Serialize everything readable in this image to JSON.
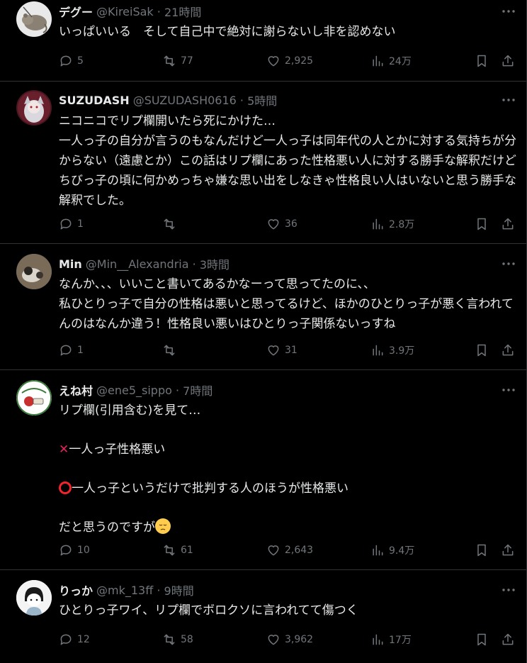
{
  "tweets": [
    {
      "name": "デグー",
      "handle": "@KireiSak",
      "time": "21時間",
      "text": "いっぱいいる　そして自己中で絶対に謝らないし非を認めない",
      "replies": "5",
      "reposts": "77",
      "likes": "2,925",
      "views": "24万"
    },
    {
      "name": "SUZUDASH",
      "handle": "@SUZUDASH0616",
      "time": "5時間",
      "text": "ニコニコでリプ欄開いたら死にかけた…\n一人っ子の自分が言うのもなんだけど一人っ子は同年代の人とかに対する気持ちが分からない（遠慮とか）この話はリプ欄にあった性格悪い人に対する勝手な解釈だけどちびっ子の頃に何かめっちゃ嫌な思い出をしなきゃ性格良い人はいないと思う勝手な解釈でした。",
      "replies": "1",
      "reposts": "",
      "likes": "36",
      "views": "2.8万"
    },
    {
      "name": "Min",
      "handle": "@Min__Alexandria",
      "time": "3時間",
      "text": "なんか、、、いいこと書いてあるかなーって思ってたのに、、\n私ひとりっ子で自分の性格は悪いと思ってるけど、ほかのひとりっ子が悪く言われてんのはなんか違う！性格良い悪いはひとりっ子関係ないっすね",
      "replies": "1",
      "reposts": "",
      "likes": "31",
      "views": "3.9万"
    },
    {
      "name": "えね村",
      "handle": "@ene5_sippo",
      "time": "7時間",
      "line1": "リプ欄(引用含む)を見て…",
      "line2": "一人っ子性格悪い",
      "line3": "一人っ子というだけで批判する人のほうが性格悪い",
      "line4": "だと思うのですが",
      "replies": "10",
      "reposts": "61",
      "likes": "2,643",
      "views": "9.4万"
    },
    {
      "name": "りっか",
      "handle": "@mk_13ff",
      "time": "9時間",
      "text": "ひとりっ子ワイ、リプ欄でボロクソに言われてて傷つく",
      "replies": "12",
      "reposts": "58",
      "likes": "3,962",
      "views": "17万"
    }
  ]
}
